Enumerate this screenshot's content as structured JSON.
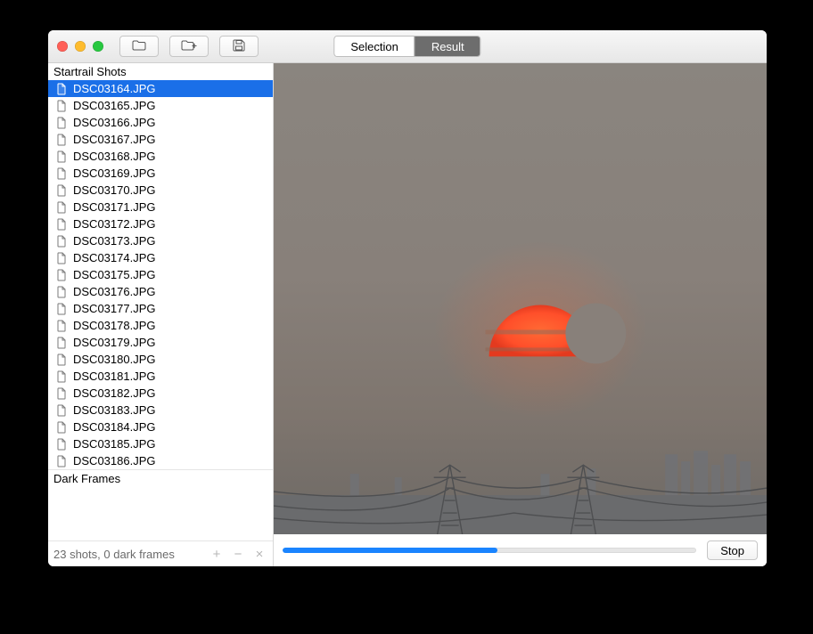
{
  "toolbar": {
    "segmented": {
      "selection": "Selection",
      "result": "Result",
      "active": "result"
    }
  },
  "sidebar": {
    "shots_header": "Startrail Shots",
    "dark_header": "Dark Frames",
    "files": [
      {
        "name": "DSC03164.JPG",
        "selected": true
      },
      {
        "name": "DSC03165.JPG",
        "selected": false
      },
      {
        "name": "DSC03166.JPG",
        "selected": false
      },
      {
        "name": "DSC03167.JPG",
        "selected": false
      },
      {
        "name": "DSC03168.JPG",
        "selected": false
      },
      {
        "name": "DSC03169.JPG",
        "selected": false
      },
      {
        "name": "DSC03170.JPG",
        "selected": false
      },
      {
        "name": "DSC03171.JPG",
        "selected": false
      },
      {
        "name": "DSC03172.JPG",
        "selected": false
      },
      {
        "name": "DSC03173.JPG",
        "selected": false
      },
      {
        "name": "DSC03174.JPG",
        "selected": false
      },
      {
        "name": "DSC03175.JPG",
        "selected": false
      },
      {
        "name": "DSC03176.JPG",
        "selected": false
      },
      {
        "name": "DSC03177.JPG",
        "selected": false
      },
      {
        "name": "DSC03178.JPG",
        "selected": false
      },
      {
        "name": "DSC03179.JPG",
        "selected": false
      },
      {
        "name": "DSC03180.JPG",
        "selected": false
      },
      {
        "name": "DSC03181.JPG",
        "selected": false
      },
      {
        "name": "DSC03182.JPG",
        "selected": false
      },
      {
        "name": "DSC03183.JPG",
        "selected": false
      },
      {
        "name": "DSC03184.JPG",
        "selected": false
      },
      {
        "name": "DSC03185.JPG",
        "selected": false
      },
      {
        "name": "DSC03186.JPG",
        "selected": false
      }
    ],
    "footer": {
      "status": "23 shots, 0 dark frames",
      "add": "+",
      "remove": "−",
      "clear": "×"
    }
  },
  "bottom": {
    "progress_percent": 52,
    "stop": "Stop"
  }
}
